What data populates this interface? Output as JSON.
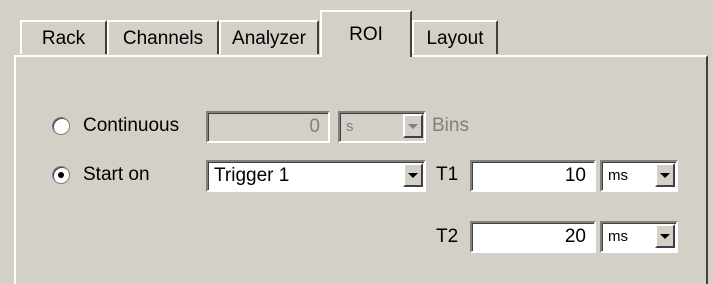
{
  "tabs": [
    {
      "label": "Rack"
    },
    {
      "label": "Channels"
    },
    {
      "label": "Analyzer"
    },
    {
      "label": "ROI"
    },
    {
      "label": "Layout"
    }
  ],
  "roi": {
    "continuous": {
      "label": "Continuous",
      "selected": false,
      "value": "0",
      "unit": "s",
      "bins_label": "Bins"
    },
    "start_on": {
      "label": "Start on",
      "selected": true,
      "trigger": "Trigger 1"
    },
    "t1": {
      "label": "T1",
      "value": "10",
      "unit": "ms"
    },
    "t2": {
      "label": "T2",
      "value": "20",
      "unit": "ms"
    }
  }
}
